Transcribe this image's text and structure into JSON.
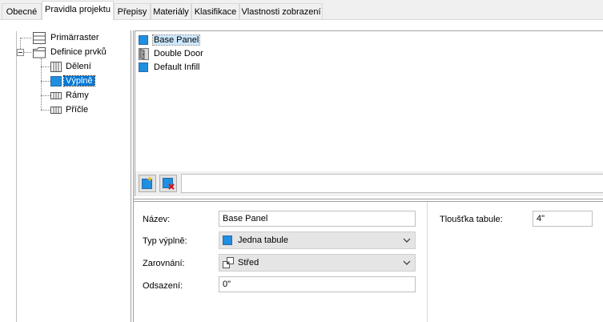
{
  "tabs": [
    {
      "label": "Obecné",
      "active": false
    },
    {
      "label": "Pravidla projektu",
      "active": true
    },
    {
      "label": "Přepisy",
      "active": false
    },
    {
      "label": "Materiály",
      "active": false
    },
    {
      "label": "Klasifikace",
      "active": false
    },
    {
      "label": "Vlastnosti zobrazení",
      "active": false
    }
  ],
  "tree": {
    "items": [
      {
        "label": "Primärraster",
        "icon": "grid-icon"
      },
      {
        "label": "Definice prvků",
        "icon": "folder-icon"
      },
      {
        "label": "Dělení",
        "icon": "division-icon"
      },
      {
        "label": "Výplně",
        "icon": "infill-icon",
        "selected": true
      },
      {
        "label": "Rámy",
        "icon": "frame-icon"
      },
      {
        "label": "Příčle",
        "icon": "mullion-icon"
      }
    ]
  },
  "list": {
    "items": [
      {
        "label": "Base Panel",
        "icon": "panel-icon",
        "selected": true
      },
      {
        "label": "Double Door",
        "icon": "door-icon"
      },
      {
        "label": "Default Infill",
        "icon": "panel-icon"
      }
    ]
  },
  "buttons": {
    "add": "add-item-icon",
    "delete": "delete-item-icon"
  },
  "form": {
    "name_label": "Název:",
    "name_value": "Base Panel",
    "type_label": "Typ výplně:",
    "type_value": "Jedna tabule",
    "align_label": "Zarovnání:",
    "align_value": "Střed",
    "offset_label": "Odsazení:",
    "offset_value": "0\"",
    "thickness_label": "Tloušťka tabule:",
    "thickness_value": "4\""
  },
  "colors": {
    "selection": "#0078d7",
    "panel": "#1f8fe0"
  }
}
